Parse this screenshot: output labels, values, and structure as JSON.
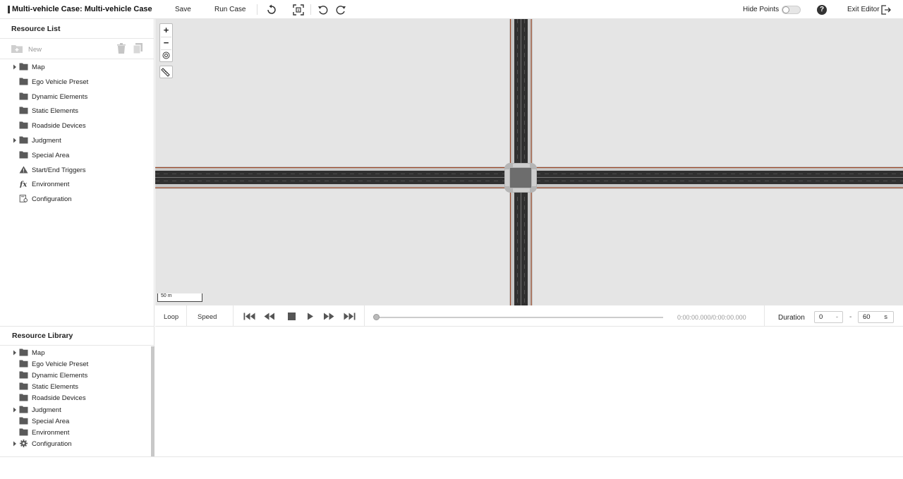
{
  "header": {
    "title": "Multi-vehicle Case: Multi-vehicle Case",
    "save_label": "Save",
    "run_label": "Run Case",
    "hide_points_label": "Hide Points",
    "hide_points_on": false,
    "exit_label": "Exit Editor"
  },
  "resource_list": {
    "title": "Resource List",
    "new_label": "New",
    "items": [
      {
        "label": "Map",
        "expandable": true,
        "icon": "folder-icon"
      },
      {
        "label": "Ego Vehicle Preset",
        "expandable": false,
        "icon": "folder-icon"
      },
      {
        "label": "Dynamic Elements",
        "expandable": false,
        "icon": "folder-icon"
      },
      {
        "label": "Static Elements",
        "expandable": false,
        "icon": "folder-icon"
      },
      {
        "label": "Roadside Devices",
        "expandable": false,
        "icon": "folder-icon"
      },
      {
        "label": "Judgment",
        "expandable": true,
        "icon": "folder-icon"
      },
      {
        "label": "Special Area",
        "expandable": false,
        "icon": "folder-icon"
      },
      {
        "label": "Start/End Triggers",
        "expandable": false,
        "icon": "warning-icon"
      },
      {
        "label": "Environment",
        "expandable": false,
        "icon": "function-icon"
      },
      {
        "label": "Configuration",
        "expandable": false,
        "icon": "config-doc-icon"
      }
    ]
  },
  "resource_library": {
    "title": "Resource Library",
    "items": [
      {
        "label": "Map",
        "expandable": true,
        "icon": "folder-icon"
      },
      {
        "label": "Ego Vehicle Preset",
        "expandable": false,
        "icon": "folder-icon"
      },
      {
        "label": "Dynamic Elements",
        "expandable": false,
        "icon": "folder-icon"
      },
      {
        "label": "Static Elements",
        "expandable": false,
        "icon": "folder-icon"
      },
      {
        "label": "Roadside Devices",
        "expandable": false,
        "icon": "folder-icon"
      },
      {
        "label": "Judgment",
        "expandable": true,
        "icon": "folder-icon"
      },
      {
        "label": "Special Area",
        "expandable": false,
        "icon": "folder-icon"
      },
      {
        "label": "Environment",
        "expandable": false,
        "icon": "folder-icon"
      },
      {
        "label": "Configuration",
        "expandable": true,
        "icon": "gear-icon"
      }
    ]
  },
  "map": {
    "scale_label": "50 m",
    "zoom_in": "+",
    "zoom_out": "−"
  },
  "playback": {
    "loop_label": "Loop",
    "speed_label": "Speed",
    "timecode": "0:00:00.000/0:00:00.000",
    "progress": 0,
    "duration_label": "Duration",
    "duration_start": "0",
    "duration_end": "60",
    "unit": "s",
    "dash": "-"
  },
  "colors": {
    "map_background": "#e5e5e5",
    "road": "#2e2e2e",
    "road_edge": "#a0522d",
    "sidewalk": "#bdbdbd"
  }
}
